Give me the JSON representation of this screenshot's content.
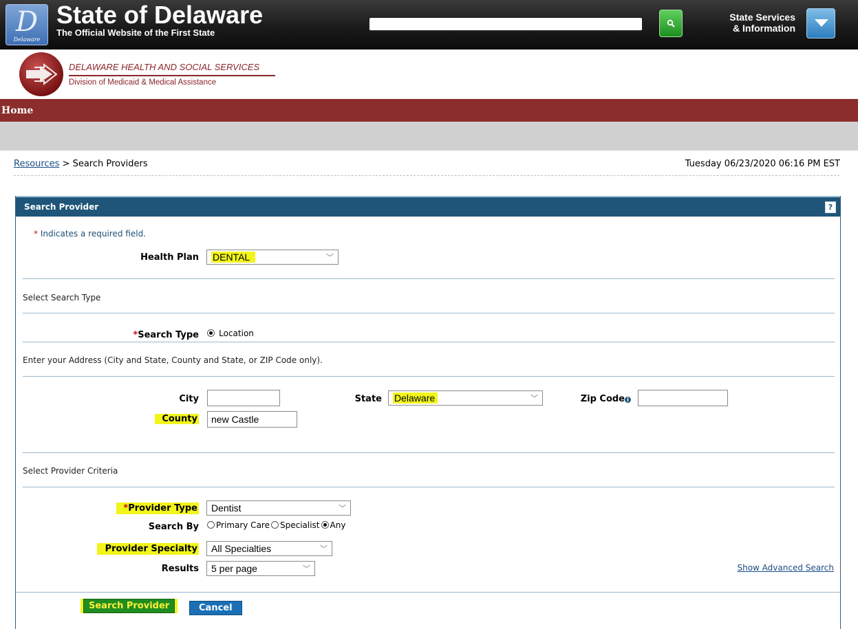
{
  "header": {
    "logo_mark": "D",
    "logo_caption": "Delaware",
    "site_title": "State of Delaware",
    "site_subtitle": "The Official Website of the First State",
    "search_value": "",
    "services_line1": "State Services",
    "services_line2": "& Information"
  },
  "agency": {
    "name": "DELAWARE HEALTH AND SOCIAL SERVICES",
    "division": "Division of Medicaid & Medical Assistance"
  },
  "nav": {
    "home": "Home"
  },
  "breadcrumb": {
    "link": "Resources",
    "separator": " > ",
    "current": "Search Providers"
  },
  "datetime": "Tuesday 06/23/2020 06:16 PM EST",
  "panel": {
    "title": "Search Provider",
    "help": "?",
    "required_star": "*",
    "required_note": "Indicates a required field.",
    "health_plan_label": "Health Plan",
    "health_plan_value": "DENTAL",
    "select_search_type": "Select Search Type",
    "search_type_label": "Search Type",
    "search_type_option": "Location",
    "address_instructions": "Enter your Address (City and State, County and State, or ZIP Code only).",
    "city_label": "City",
    "city_value": "",
    "state_label": "State",
    "state_value": "Delaware",
    "zip_label": "Zip Code",
    "zip_value": "",
    "county_label": "County",
    "county_value": "new Castle",
    "select_provider_criteria": "Select Provider Criteria",
    "provider_type_label": "Provider Type",
    "provider_type_value": "Dentist",
    "search_by_label": "Search By",
    "search_by_options": [
      "Primary Care",
      "Specialist",
      "Any"
    ],
    "search_by_selected": "Any",
    "provider_specialty_label": "Provider Specialty",
    "provider_specialty_value": "All Specialties",
    "results_label": "Results",
    "results_value": "5 per page",
    "advanced_link": "Show Advanced Search",
    "search_button": "Search Provider",
    "cancel_button": "Cancel"
  },
  "colors": {
    "nav_bar": "#8b2d2d",
    "panel_header": "#1e5578",
    "highlight": "#f2f51a",
    "search_button": "#1f8d1f",
    "cancel_button": "#1a6fb5"
  }
}
